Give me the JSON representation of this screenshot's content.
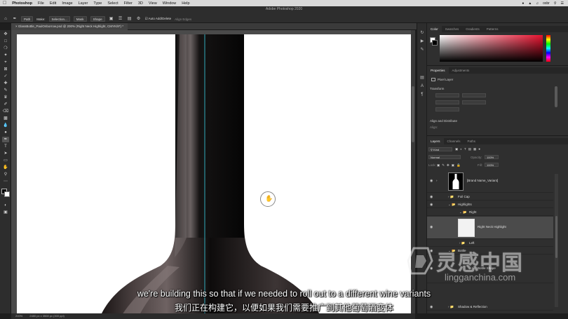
{
  "menubar": {
    "app_name": "Photoshop",
    "items": [
      "File",
      "Edit",
      "Image",
      "Layer",
      "Type",
      "Select",
      "Filter",
      "3D",
      "View",
      "Window",
      "Help"
    ],
    "user": "oxbr"
  },
  "window_title": "Adobe Photoshop 2020",
  "options_bar": {
    "tool_mode": "Path",
    "make_label": "Make:",
    "selection_button": "Selection...",
    "mask_button": "Mask",
    "shape_button": "Shape",
    "auto_add_delete": "Auto Add/Delete",
    "align_edges": "Align Edges"
  },
  "document_tab": {
    "label": "GlassBottle_PaulOnborrow.psd @ 200% (Right Neck Highlight, CMYK/8*) *"
  },
  "status_bar": {
    "zoom": "200%",
    "doc_size": "2480 px x 3508 px (300 ppi)"
  },
  "color_panel": {
    "tabs": [
      "Color",
      "Swatches",
      "Gradients",
      "Patterns"
    ],
    "active_tab": "Color"
  },
  "properties_panel": {
    "tabs": [
      "Properties",
      "Adjustments"
    ],
    "active_tab": "Properties",
    "layer_type": "Pixel Layer",
    "transform_label": "Transform",
    "align_distribute_label": "Align and Distribute",
    "align_label": "Align:"
  },
  "layers_panel": {
    "tabs": [
      "Layers",
      "Channels",
      "Paths"
    ],
    "active_tab": "Layers",
    "filter_kind": "Kind",
    "blend_mode": "Normal",
    "opacity_label": "Opacity:",
    "opacity_value": "100%",
    "lock_label": "Lock:",
    "fill_label": "Fill:",
    "fill_value": "100%",
    "layers": [
      {
        "name": "[Brand Name_Variant]",
        "indent": 0,
        "kind": "smart"
      },
      {
        "name": "Foil Cap",
        "indent": 1,
        "kind": "group"
      },
      {
        "name": "Highlights",
        "indent": 1,
        "kind": "group"
      },
      {
        "name": "Right",
        "indent": 2,
        "kind": "group"
      },
      {
        "name": "Right Neck Highlight",
        "indent": 3,
        "kind": "layer",
        "selected": true
      },
      {
        "name": "Left",
        "indent": 2,
        "kind": "group"
      },
      {
        "name": "Bottle",
        "indent": 1,
        "kind": "group"
      },
      {
        "name": "Bottle Shape",
        "indent": 2,
        "kind": "layer"
      },
      {
        "name": "Shadow & Reflection",
        "indent": 1,
        "kind": "group"
      }
    ]
  },
  "subtitles": {
    "english": "we're building this so that if we needed to roll out to a different wine variants",
    "chinese": "我们正在构建它，以便如果我们需要推广到其他葡萄酒变体"
  },
  "watermark": {
    "brand": "灵感中国",
    "url": "lingganchina.com"
  }
}
